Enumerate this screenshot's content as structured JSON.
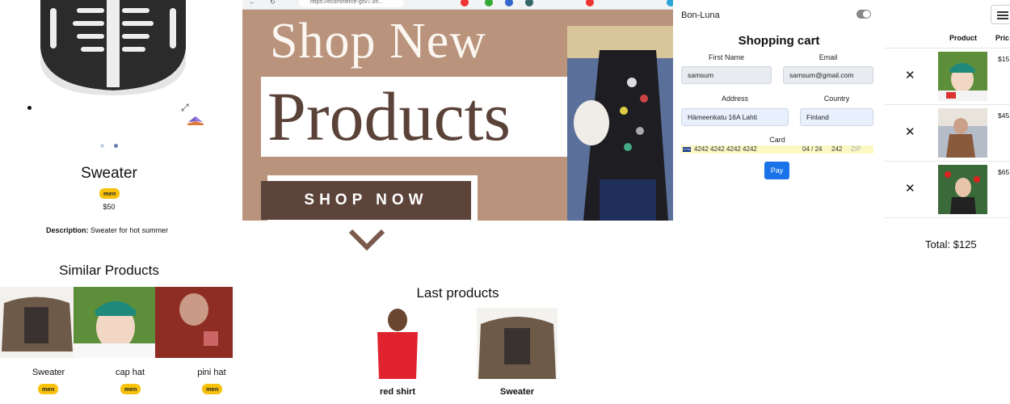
{
  "product_page": {
    "title": "Sweater",
    "badge": "men",
    "price": "$50",
    "description_label": "Description:",
    "description_text": "Sweater for hot summer",
    "similar_title": "Similar Products",
    "similar_items": [
      {
        "label": "Sweater",
        "badge": "men"
      },
      {
        "label": "cap hat",
        "badge": "men"
      },
      {
        "label": "pini hat",
        "badge": "men"
      }
    ]
  },
  "browser": {
    "url": "https://ecommerce-gsv7.on..."
  },
  "banner": {
    "headline": "Shop New",
    "products_text": "Products",
    "cta": "SHOP NOW"
  },
  "last_products": {
    "title": "Last products",
    "items": [
      {
        "label": "red shirt"
      },
      {
        "label": "Sweater"
      }
    ]
  },
  "cart_form": {
    "brand": "Bon-Luna",
    "title": "Shopping cart",
    "first_name_label": "First Name",
    "first_name_value": "samsum",
    "email_label": "Email",
    "email_value": "samsum@gmail.com",
    "address_label": "Address",
    "address_value": "Hämeenkatu 16A Lahti",
    "country_label": "Country",
    "country_value": "Finland",
    "card_label": "Card",
    "card_number": "4242 4242 4242 4242",
    "card_expiry": "04 / 24",
    "card_cvc": "242",
    "card_zip_placeholder": "ZIP",
    "pay_label": "Pay"
  },
  "cart_table": {
    "header_product": "Product",
    "header_price": "Pric",
    "rows": [
      {
        "price": "$15"
      },
      {
        "price": "$45"
      },
      {
        "price": "$65"
      }
    ],
    "total": "Total: $125"
  },
  "colors": {
    "badge": "#f7c10c",
    "banner_bg": "#b9937b",
    "cta_bg": "#5c443a",
    "pay_button": "#1a73e8"
  }
}
